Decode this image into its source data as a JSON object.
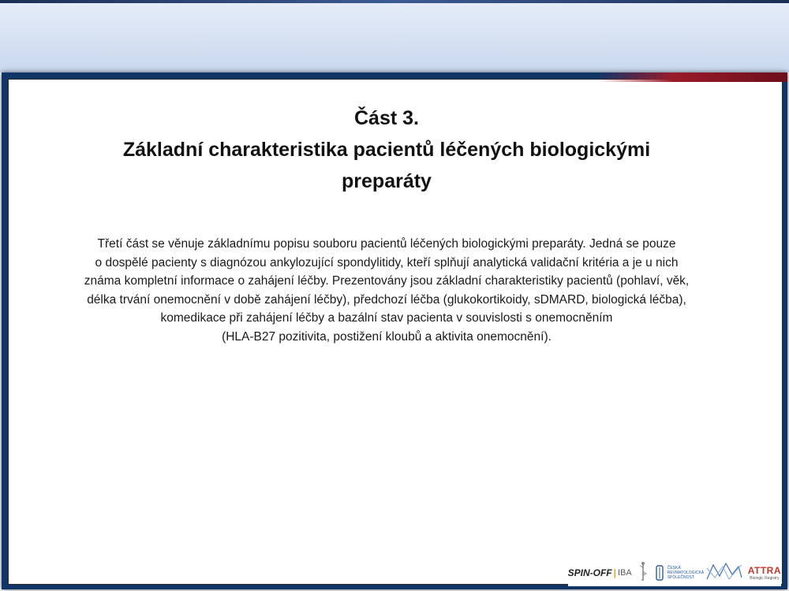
{
  "slide": {
    "title_lines": [
      "Část 3.",
      "Základní charakteristika pacientů léčených biologickými",
      "preparáty"
    ],
    "body_lines": [
      "Třetí část se věnuje základnímu popisu souboru pacientů léčených biologickými preparáty. Jedná se pouze",
      "o dospělé pacienty s diagnózou ankylozující spondylitidy, kteří splňují analytická validační kritéria a je u nich",
      "známa kompletní informace o zahájení léčby. Prezentovány jsou základní charakteristiky pacientů (pohlaví, věk,",
      "délka trvání onemocnění v době zahájení léčby), předchozí léčba (glukokortikoidy, sDMARD, biologická léčba),",
      "komedikace při zahájení léčby a bazální stav pacienta v souvislosti s onemocněním",
      "(HLA-B27 pozitivita, postižení kloubů a aktivita onemocnění)."
    ]
  },
  "footer": {
    "spinoff_label": "SPIN-OFF",
    "iba_label": "IBA",
    "cezka_label": "ČESKÁ REVMATOLOGICKÁ SPOLEČNOST",
    "attra_label": "ATTRA",
    "attra_sub": "Biologic Registry",
    "icons": [
      "logo-spinoff-icon",
      "caduceus-icon",
      "logo-cezka-icon",
      "network-icon",
      "logo-attra-icon"
    ]
  },
  "colors": {
    "frame_blue": "#123567",
    "accent_red": "#9a1b2a",
    "header_band": "#c9d8ee"
  }
}
